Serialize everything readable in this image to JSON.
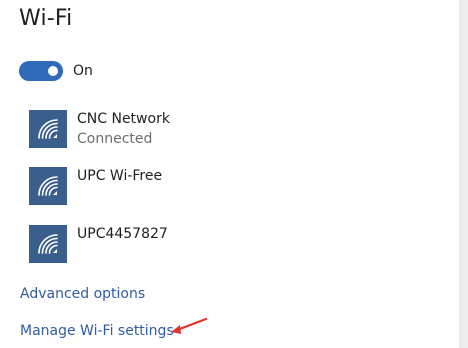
{
  "header": {
    "title": "Wi-Fi"
  },
  "wifi_toggle": {
    "state_label": "On",
    "is_on": true,
    "color": "#2f6bb8"
  },
  "networks": [
    {
      "name": "CNC Network",
      "status": "Connected",
      "icon": "wifi-signal-icon"
    },
    {
      "name": "UPC Wi-Free",
      "status": "",
      "icon": "wifi-signal-icon"
    },
    {
      "name": "UPC4457827",
      "status": "",
      "icon": "wifi-signal-icon"
    }
  ],
  "links": {
    "advanced_options": "Advanced options",
    "manage_settings": "Manage Wi-Fi settings"
  },
  "colors": {
    "accent": "#2f6bb8",
    "tile": "#3a5f8c",
    "link": "#2f5d9e",
    "annotation_arrow": "#e2332b"
  }
}
